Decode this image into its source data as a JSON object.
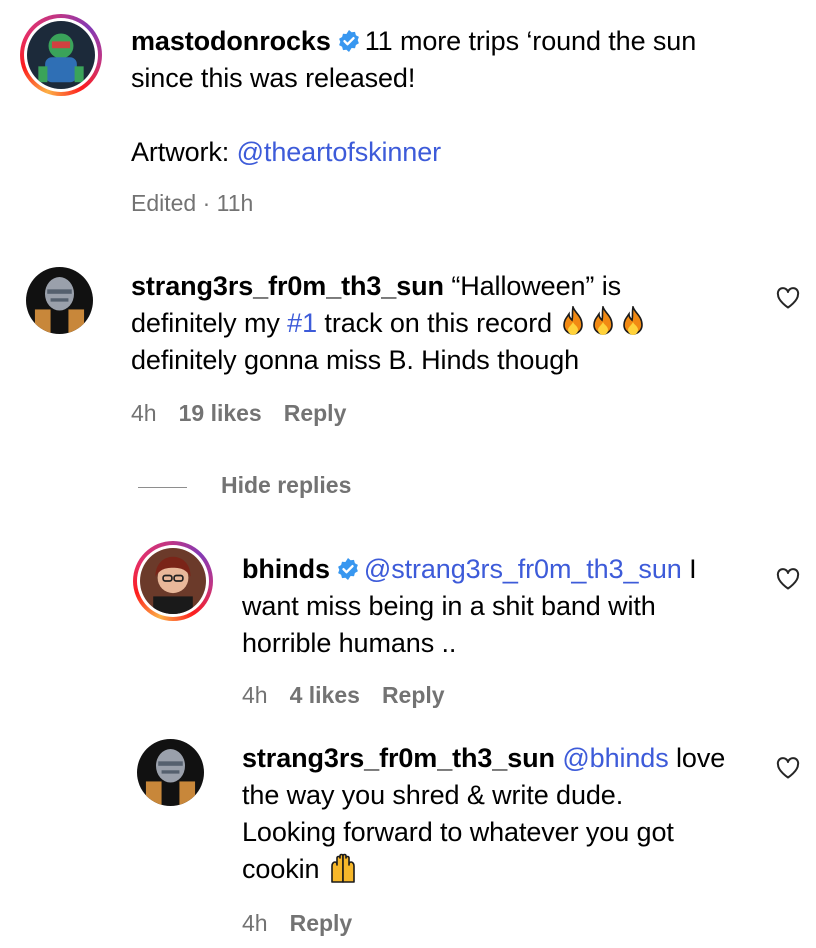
{
  "comments": [
    {
      "username": "mastodonrocks",
      "verified": true,
      "text_line1": "11 more trips ‘round the sun",
      "text_line2": "since this was released!",
      "artwork_label": "Artwork:",
      "artwork_mention": "@theartofskinner",
      "meta_edited": "Edited · 11h"
    },
    {
      "username": "strang3rs_fr0m_th3_sun",
      "text_part1": "“Halloween” is",
      "text_part2": "definitely my",
      "hashtag": "#1",
      "text_part3": "track on this record",
      "text_line3": "definitely gonna miss B. Hinds though",
      "time": "4h",
      "likes": "19 likes",
      "reply_label": "Reply"
    },
    {
      "username": "bhinds",
      "verified": true,
      "mention": "@strang3rs_fr0m_th3_sun",
      "text_part1": "I",
      "text_line2": "want miss being in a shit band with",
      "text_line3": "horrible humans ..",
      "time": "4h",
      "likes": "4 likes",
      "reply_label": "Reply"
    },
    {
      "username": "strang3rs_fr0m_th3_sun",
      "mention": "@bhinds",
      "text_part1": "love",
      "text_line2": "the way you shred & write dude.",
      "text_line3": "Looking forward to whatever you got",
      "text_line4": "cookin",
      "time": "4h",
      "reply_label": "Reply"
    }
  ],
  "hide_replies_label": "Hide replies",
  "icons": {
    "verified": "verified-badge-icon",
    "like": "heart-icon",
    "fire": "fire-emoji-icon",
    "raised_hands": "raised-hands-emoji-icon"
  },
  "colors": {
    "mention": "#3d5bd9",
    "meta": "#737373",
    "verified": "#3897f0"
  }
}
